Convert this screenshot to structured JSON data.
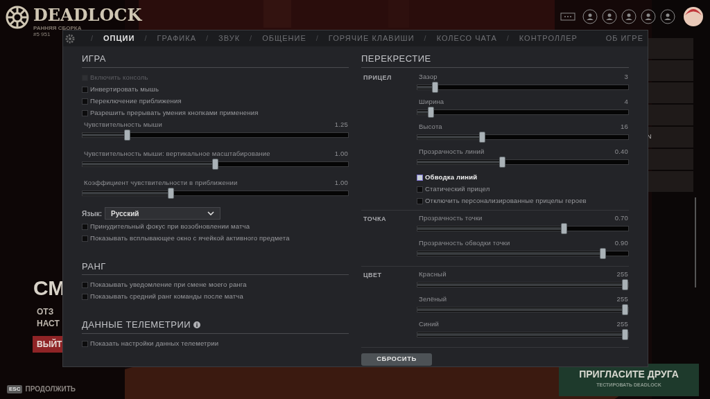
{
  "brand": {
    "name": "DEADLOCK",
    "subtitle": "РАННЯЯ СБОРКА",
    "build": "#5 951"
  },
  "background": {
    "headline": "СМ",
    "lines": [
      "ОТЗ",
      "НАСТ"
    ],
    "exit_button": "ВЫЙТ",
    "tile_letter": "N",
    "invite": {
      "title": "ПРИГЛАСИТЕ ДРУГА",
      "subtitle": "ТЕСТИРОВАТЬ DEADLOCK"
    }
  },
  "tabs": [
    {
      "label": "ОПЦИИ",
      "selected": true
    },
    {
      "label": "ГРАФИКА",
      "selected": false
    },
    {
      "label": "ЗВУК",
      "selected": false
    },
    {
      "label": "ОБЩЕНИЕ",
      "selected": false
    },
    {
      "label": "ГОРЯЧИЕ КЛАВИШИ",
      "selected": false
    },
    {
      "label": "КОЛЕСО ЧАТА",
      "selected": false
    },
    {
      "label": "КОНТРОЛЛЕР",
      "selected": false
    }
  ],
  "tab_separator": "/",
  "about_tab": {
    "label": "ОБ ИГРЕ",
    "selected": false
  },
  "left_sections": [
    {
      "title": "ИГРА",
      "items": [
        {
          "kind": "checkbox",
          "label": "Включить консоль",
          "checked": false,
          "disabled": true
        },
        {
          "kind": "checkbox",
          "label": "Инвертировать мышь",
          "checked": false,
          "disabled": false
        },
        {
          "kind": "checkbox",
          "label": "Переключение приближения",
          "checked": false,
          "disabled": false
        },
        {
          "kind": "checkbox",
          "label": "Разрешить прерывать умения кнопками применения",
          "checked": false,
          "disabled": false
        },
        {
          "kind": "slider",
          "label": "Чувствительность мыши",
          "reading": "1.25",
          "level": 0.16
        },
        {
          "kind": "slider",
          "label": "Чувствительность мыши: вертикальное масштабирование",
          "reading": "1.00",
          "level": 0.5
        },
        {
          "kind": "slider",
          "label": "Коэффициент чувствительности в приближении",
          "reading": "1.00",
          "level": 0.33
        },
        {
          "kind": "dropdown",
          "label": "Язык:",
          "value": "Русский"
        },
        {
          "kind": "checkbox",
          "label": "Принудительный фокус при возобновлении матча",
          "checked": false,
          "disabled": false
        },
        {
          "kind": "checkbox",
          "label": "Показывать всплывающее окно с ячейкой активного предмета",
          "checked": false,
          "disabled": false
        }
      ]
    },
    {
      "title": "РАНГ",
      "items": [
        {
          "kind": "checkbox",
          "label": "Показывать уведомление при смене моего ранга",
          "checked": false,
          "disabled": false
        },
        {
          "kind": "checkbox",
          "label": "Показывать средний ранг команды после матча",
          "checked": false,
          "disabled": false
        }
      ]
    },
    {
      "title": "ДАННЫЕ ТЕЛЕМЕТРИИ",
      "info": true,
      "items": [
        {
          "kind": "checkbox",
          "label": "Показать настройки данных телеметрии",
          "checked": false,
          "disabled": false
        }
      ]
    }
  ],
  "crosshair": {
    "title": "ПЕРЕКРЕСТИЕ",
    "groups": [
      {
        "label": "ПРИЦЕЛ",
        "items": [
          {
            "kind": "slider",
            "label": "Зазор",
            "reading": "3",
            "level": 0.07
          },
          {
            "kind": "slider",
            "label": "Ширина",
            "reading": "4",
            "level": 0.05
          },
          {
            "kind": "slider",
            "label": "Высота",
            "reading": "16",
            "level": 0.3
          },
          {
            "kind": "slider",
            "label": "Прозрачность линий",
            "reading": "0.40",
            "level": 0.4
          },
          {
            "kind": "checkbox",
            "label": "Обводка линий",
            "checked": true,
            "disabled": false
          },
          {
            "kind": "checkbox",
            "label": "Статический прицел",
            "checked": false,
            "disabled": false
          },
          {
            "kind": "checkbox",
            "label": "Отключить персонализированные прицелы героев",
            "checked": false,
            "disabled": false
          }
        ]
      },
      {
        "label": "ТОЧКА",
        "items": [
          {
            "kind": "slider",
            "label": "Прозрачность точки",
            "reading": "0.70",
            "level": 0.7
          },
          {
            "kind": "slider",
            "label": "Прозрачность обводки точки",
            "reading": "0.90",
            "level": 0.89
          }
        ]
      },
      {
        "label": "ЦВЕТ",
        "items": [
          {
            "kind": "slider",
            "label": "Красный",
            "reading": "255",
            "level": 1
          },
          {
            "kind": "slider",
            "label": "Зелёный",
            "reading": "255",
            "level": 1
          },
          {
            "kind": "slider",
            "label": "Синий",
            "reading": "255",
            "level": 1
          }
        ]
      }
    ]
  },
  "reset_button": "СБРОСИТЬ",
  "footer": {
    "key": "ESC",
    "label": "ПРОДОЛЖИТЬ"
  }
}
